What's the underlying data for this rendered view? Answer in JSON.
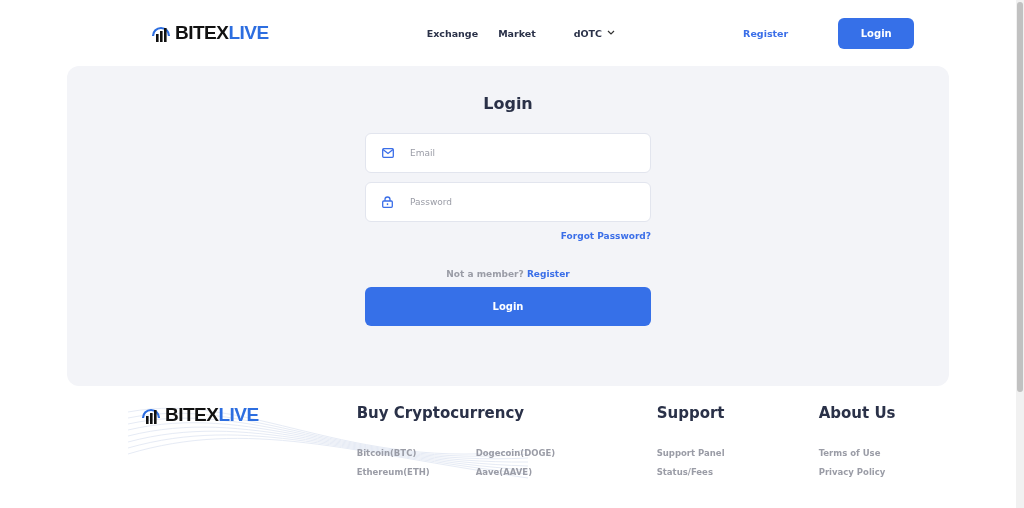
{
  "header": {
    "logo": {
      "part_1": "BITEX",
      "part_2": "LIVE"
    },
    "nav": [
      {
        "label": "Exchange",
        "kind": "link"
      },
      {
        "label": "Market",
        "kind": "link"
      },
      {
        "label": "dOTC",
        "kind": "dropdown"
      }
    ],
    "register": "Register",
    "login": "Login"
  },
  "login_card": {
    "title": "Login",
    "email": {
      "placeholder": "Email"
    },
    "password": {
      "placeholder": "Password"
    },
    "forgot": "Forgot Password?",
    "not_member": "Not a member?",
    "register_link": "Register",
    "submit": "Login"
  },
  "footer": {
    "logo": {
      "part_1": "BITEX",
      "part_2": "LIVE"
    },
    "columns": [
      {
        "title": "Buy Cryptocurrency",
        "kind": "grid",
        "links": [
          "Bitcoin(BTC)",
          "Dogecoin(DOGE)",
          "Ethereum(ETH)",
          "Aave(AAVE)"
        ]
      },
      {
        "title": "Support",
        "kind": "list",
        "links": [
          "Support Panel",
          "Status/Fees"
        ]
      },
      {
        "title": "About Us",
        "kind": "list",
        "links": [
          "Terms of Use",
          "Privacy Policy"
        ]
      }
    ]
  }
}
